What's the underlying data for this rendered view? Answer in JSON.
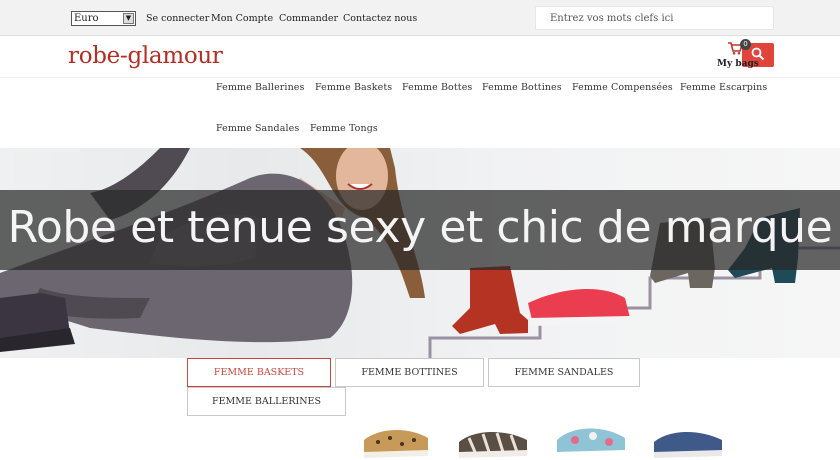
{
  "topbar": {
    "currency": "Euro",
    "links": [
      "Se connecter",
      "Mon Compte",
      "Commander",
      "Contactez nous"
    ],
    "search_placeholder": "Entrez vos mots clefs ici"
  },
  "header": {
    "logo": "robe-glamour",
    "cart_count": "0",
    "cart_label": "My bags"
  },
  "nav": {
    "categories": [
      "Femme Ballerines",
      "Femme Baskets",
      "Femme Bottes",
      "Femme Bottines",
      "Femme Compensées",
      "Femme Escarpins",
      "Femme Sandales",
      "Femme Tongs"
    ]
  },
  "hero": {
    "title": "Robe et tenue sexy et chic de marque"
  },
  "tabs": {
    "items": [
      "FEMME BASKETS",
      "FEMME BOTTINES",
      "FEMME SANDALES",
      "FEMME BALLERINES"
    ],
    "active": "FEMME BASKETS"
  },
  "colors": {
    "brand": "#b52e25",
    "accent": "#e0453c",
    "tab_active": "#c8443c"
  },
  "icons": [
    "dropdown-arrow-icon",
    "cart-icon",
    "search-icon"
  ]
}
